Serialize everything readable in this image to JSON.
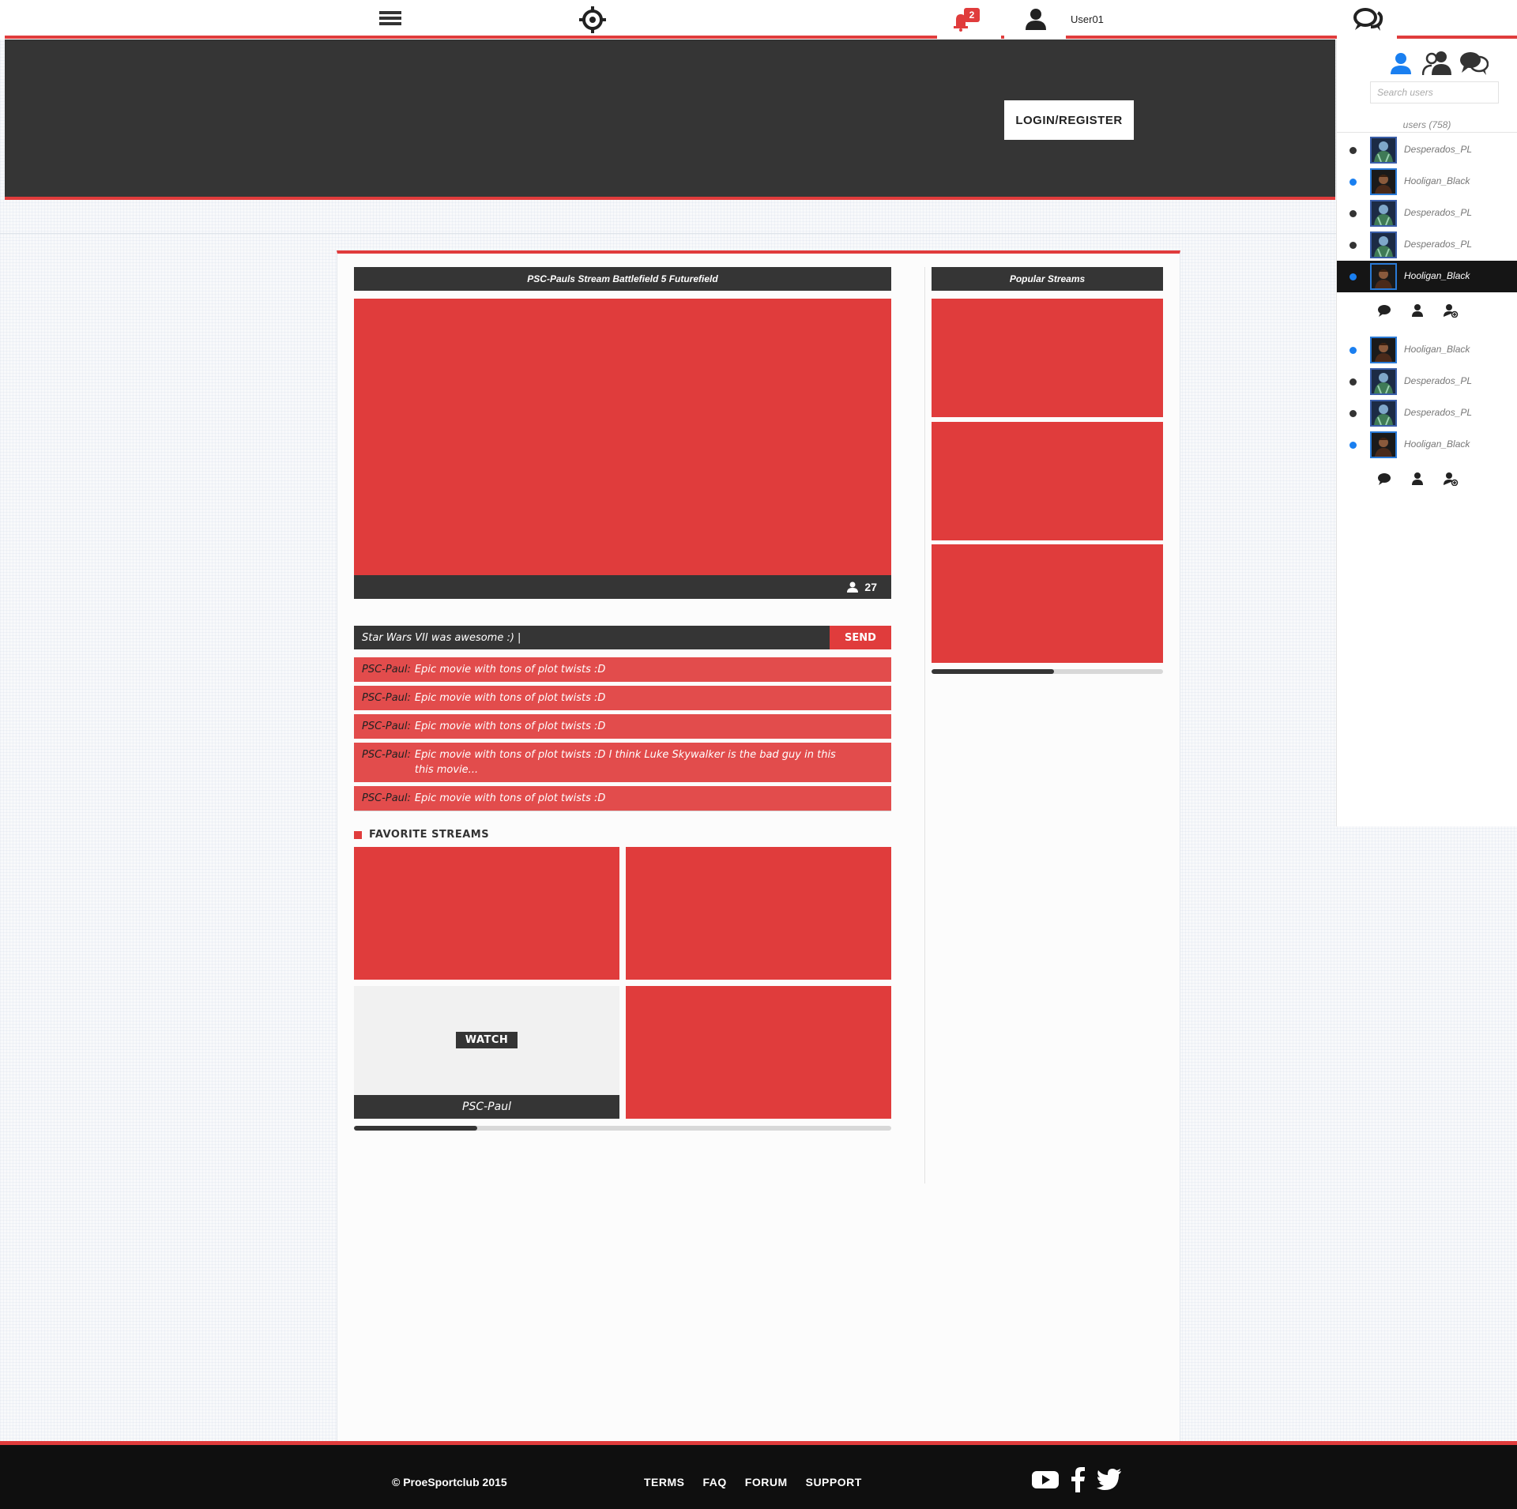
{
  "topbar": {
    "icons": [
      "menu-icon",
      "crosshair-icon",
      "bell-icon",
      "user-icon",
      "chat-bubbles-icon"
    ],
    "notification_count": "2",
    "username": "User01"
  },
  "hero": {
    "login_label": "LOGIN/REGISTER"
  },
  "stream": {
    "title": "PSC-Pauls Stream Battlefield 5 Futurefield",
    "viewers": "27",
    "viewer_icon": "person-icon"
  },
  "chat": {
    "input_value": "Star Wars VII was awesome :) |",
    "send_label": "SEND",
    "messages": [
      {
        "author": "PSC-Paul:",
        "text": "Epic movie with tons of plot twists :D"
      },
      {
        "author": "PSC-Paul:",
        "text": "Epic movie with tons of plot twists :D"
      },
      {
        "author": "PSC-Paul:",
        "text": "Epic movie with tons of plot twists :D"
      },
      {
        "author": "PSC-Paul:",
        "text": "Epic movie with tons of plot twists :D I think Luke Skywalker is the bad guy in this this movie..."
      },
      {
        "author": "PSC-Paul:",
        "text": "Epic movie with tons of plot twists :D"
      }
    ]
  },
  "favorites": {
    "heading": "FAVORITE STREAMS",
    "watch_label": "WATCH",
    "hover_caption": "PSC-Paul",
    "scroll_fraction": 0.23
  },
  "popular": {
    "title": "Popular Streams",
    "scroll_fraction": 0.53
  },
  "sidebar": {
    "tab_icons": [
      "single-user-icon",
      "group-users-icon",
      "chat-bubbles-icon"
    ],
    "search_placeholder": "Search users",
    "count_label": "users (758)",
    "group1": [
      {
        "name": "Desperados_PL",
        "online": false,
        "active": false,
        "avatar": "green"
      },
      {
        "name": "Hooligan_Black",
        "online": true,
        "active": false,
        "avatar": "dark"
      },
      {
        "name": "Desperados_PL",
        "online": false,
        "active": false,
        "avatar": "green"
      },
      {
        "name": "Desperados_PL",
        "online": false,
        "active": false,
        "avatar": "green"
      },
      {
        "name": "Hooligan_Black",
        "online": true,
        "active": true,
        "avatar": "dark"
      }
    ],
    "group2": [
      {
        "name": "Hooligan_Black",
        "online": true,
        "active": false,
        "avatar": "dark"
      },
      {
        "name": "Desperados_PL",
        "online": false,
        "active": false,
        "avatar": "green"
      },
      {
        "name": "Desperados_PL",
        "online": false,
        "active": false,
        "avatar": "green"
      },
      {
        "name": "Hooligan_Black",
        "online": true,
        "active": false,
        "avatar": "dark"
      }
    ],
    "action_icons": [
      "chat-icon",
      "profile-icon",
      "add-friend-icon"
    ]
  },
  "footer": {
    "copyright": "© ProeSportclub 2015",
    "links": [
      "TERMS",
      "FAQ",
      "FORUM",
      "SUPPORT"
    ],
    "social_icons": [
      "youtube-icon",
      "facebook-icon",
      "twitter-icon"
    ]
  },
  "colors": {
    "accent": "#e03c3c",
    "dark": "#353535",
    "online": "#1a7ff0",
    "footer_bg": "#0f0f0f"
  }
}
